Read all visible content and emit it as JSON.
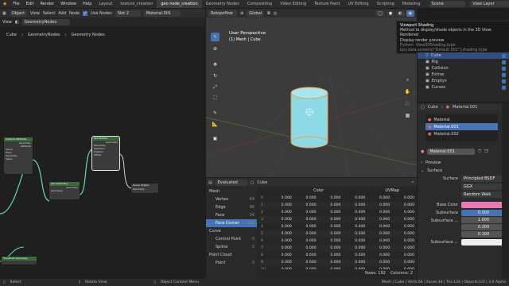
{
  "topbar": {
    "menus": [
      "File",
      "Edit",
      "Render",
      "Window",
      "Help"
    ],
    "workspaces": [
      "Layout",
      "texture_creation",
      "geo node_creation",
      "Geometry Nodes",
      "Compositing",
      "Video Editing",
      "Texture Paint",
      "UV Editing",
      "Scripting",
      "Modeling"
    ],
    "active_workspace": "geo node_creation",
    "scene": "Scene",
    "view_layer": "View Layer"
  },
  "node_editor": {
    "mode": "Object",
    "menus": [
      "View",
      "Select",
      "Add",
      "Node"
    ],
    "use_nodes_label": "Use Nodes",
    "slot": "Slot 2",
    "material": "Material.001",
    "breadcrumb": [
      "Cube",
      "GeometryNodes",
      "Geometry Nodes"
    ],
    "tab_label": "GeometryNodes",
    "nodes": {
      "capture": {
        "title": "Capture Attribute",
        "rows": [
          "Geometry",
          "Attribute",
          "Vector",
          "Point",
          "Geometry",
          "Value"
        ]
      },
      "join": {
        "title": "Join Geometry",
        "rows": [
          "Geometry",
          "Geometry"
        ]
      },
      "set": {
        "title": "Set Position",
        "rows": [
          "Geometry",
          "Geometry",
          "Selection",
          "Position",
          "Offset"
        ]
      },
      "output": {
        "title": "Group Output",
        "rows": [
          "Geometry"
        ]
      },
      "bottom": {
        "title": "Transform Geometry"
      }
    }
  },
  "viewport": {
    "tool": "Retopoflow",
    "orientation": "Global",
    "title": "User Perspective",
    "subtitle": "(1) Mesh | Cube"
  },
  "tooltip": {
    "title": "Viewport Shading",
    "line1": "Method to display/shade objects in the 3D View: Rendered",
    "line2": "Display render preview",
    "python1": "Python: View3DShading.type",
    "python2": "bpy.data.screens[\"Default.001\"].shading.type"
  },
  "spreadsheet": {
    "mode": "Evaluated",
    "object": "Cube",
    "tree": [
      {
        "label": "Mesh",
        "count": "",
        "indent": 0
      },
      {
        "label": "Vertex",
        "count": "64",
        "indent": 1
      },
      {
        "label": "Edge",
        "count": "96",
        "indent": 1
      },
      {
        "label": "Face",
        "count": "34",
        "indent": 1
      },
      {
        "label": "Face Corner",
        "count": "192",
        "indent": 1
      },
      {
        "label": "Curve",
        "count": "",
        "indent": 0
      },
      {
        "label": "Control Point",
        "count": "0",
        "indent": 1
      },
      {
        "label": "Spline",
        "count": "0",
        "indent": 1
      },
      {
        "label": "Point Cloud",
        "count": "",
        "indent": 0
      },
      {
        "label": "Point",
        "count": "0",
        "indent": 1
      }
    ],
    "selected_domain": "Face Corner",
    "columns": [
      "",
      "Color",
      "",
      "",
      "",
      "UVMap",
      ""
    ],
    "rows": [
      [
        "0",
        "0.000",
        "0.000",
        "0.000",
        "0.000",
        "0.000",
        "0.000"
      ],
      [
        "1",
        "0.000",
        "0.000",
        "0.000",
        "0.000",
        "0.000",
        "0.000"
      ],
      [
        "2",
        "0.000",
        "0.000",
        "0.000",
        "0.000",
        "0.000",
        "0.000"
      ],
      [
        "3",
        "0.000",
        "0.000",
        "0.000",
        "0.000",
        "0.000",
        "0.000"
      ],
      [
        "4",
        "0.000",
        "0.000",
        "0.000",
        "0.000",
        "0.000",
        "0.000"
      ],
      [
        "5",
        "0.000",
        "0.000",
        "0.000",
        "0.000",
        "0.000",
        "0.000"
      ],
      [
        "6",
        "0.000",
        "0.000",
        "0.000",
        "0.000",
        "0.000",
        "0.000"
      ],
      [
        "7",
        "0.000",
        "0.000",
        "0.000",
        "0.000",
        "0.000",
        "0.000"
      ],
      [
        "8",
        "0.000",
        "0.000",
        "0.000",
        "0.000",
        "0.000",
        "0.000"
      ],
      [
        "9",
        "0.000",
        "0.000",
        "0.000",
        "0.000",
        "0.000",
        "0.000"
      ],
      [
        "10",
        "0.000",
        "0.000",
        "0.000",
        "0.000",
        "0.000",
        "0.000"
      ]
    ],
    "rows_label": "Rows: 192",
    "columns_label": "Columns: 2"
  },
  "outliner": {
    "items": [
      "Cube",
      "Rig",
      "Collision",
      "Extras",
      "Emptys",
      "Curves"
    ]
  },
  "properties": {
    "object": "Cube",
    "material_name": "Material.001",
    "slots": [
      "Material",
      "Material.001",
      "Material.002"
    ],
    "selected_slot": "Material.001",
    "field_material": "Material.001",
    "preview_label": "Preview",
    "surface_section": "Surface",
    "surface_label": "Surface",
    "surface_value": "Principled BSDF",
    "ggx": "GGX",
    "random_walk": "Random Walk",
    "base_color_label": "Base Color",
    "base_color": "#e978b6",
    "subsurface_label": "Subsurface",
    "subsurface_value": "0.000",
    "subsurface_r_label": "Subsurface ...",
    "subsurface_r": [
      "1.000",
      "0.200",
      "0.100"
    ],
    "subsurface2_label": "Subsurface ..."
  },
  "statusbar": {
    "select": "Select",
    "rotate": "Rotate View",
    "context": "Object Context Menu",
    "stats": "Mesh | Cube | Verts:64 | Faces:34 | Tris:124 | Objects:1/3 | 3.0 Alpha"
  },
  "colors": {
    "accent": "#4772b3",
    "cyan_mesh": "#8dd9e6",
    "node_link": "#6bd6b3"
  }
}
